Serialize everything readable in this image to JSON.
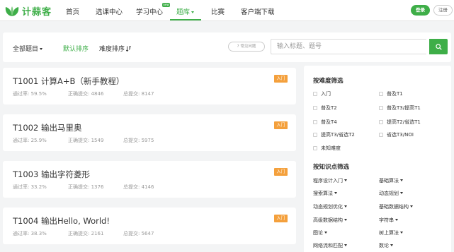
{
  "header": {
    "logo_text": "计蒜客",
    "nav": [
      {
        "label": "首页",
        "active": false
      },
      {
        "label": "选课中心",
        "active": false
      },
      {
        "label": "学习中心",
        "active": false,
        "badge": "new"
      },
      {
        "label": "题库",
        "active": true,
        "dropdown": true
      },
      {
        "label": "比赛",
        "active": false
      },
      {
        "label": "客户端下载",
        "active": false
      }
    ],
    "login_label": "登录",
    "register_label": "注册"
  },
  "filterbar": {
    "category_label": "全部题目",
    "sort_default": "默认排序",
    "sort_difficulty": "难度排序",
    "faq_label": "常见问题",
    "search_placeholder": "输入标题、题号"
  },
  "stat_labels": {
    "pass_rate": "通过率:",
    "correct": "正确提交:",
    "total": "总提交:"
  },
  "problems": [
    {
      "title": "T1001  计算A+B（新手教程）",
      "pass_rate": "59.5%",
      "correct": "4846",
      "total": "8147",
      "level": "入门"
    },
    {
      "title": "T1002  输出马里奥",
      "pass_rate": "25.9%",
      "correct": "1549",
      "total": "5975",
      "level": "入门"
    },
    {
      "title": "T1003  输出字符菱形",
      "pass_rate": "33.2%",
      "correct": "1376",
      "total": "4146",
      "level": "入门"
    },
    {
      "title": "T1004  输出Hello, World!",
      "pass_rate": "38.3%",
      "correct": "2161",
      "total": "5647",
      "level": "入门"
    }
  ],
  "sidebar": {
    "difficulty_title": "按难度筛选",
    "difficulties": [
      "入门",
      "普及T1",
      "普及T2",
      "普及T3/提高T1",
      "普及T4",
      "提高T2/省选T1",
      "提高T3/省选T2",
      "省选T3/NOI",
      "未知难度"
    ],
    "knowledge_title": "按知识点筛选",
    "knowledge": [
      "程序设计入门",
      "基础算法",
      "搜索算法",
      "动态规划",
      "动态规划优化",
      "基础数据结构",
      "高级数据结构",
      "字符串",
      "图论",
      "树上算法",
      "网络流和匹配",
      "数论"
    ]
  },
  "colors": {
    "brand": "#3eae48",
    "badge": "#f4a03c"
  },
  "icons": [
    "leaf-logo-icon",
    "caret-down-icon",
    "sort-descending-icon",
    "help-circle-icon",
    "search-icon"
  ]
}
